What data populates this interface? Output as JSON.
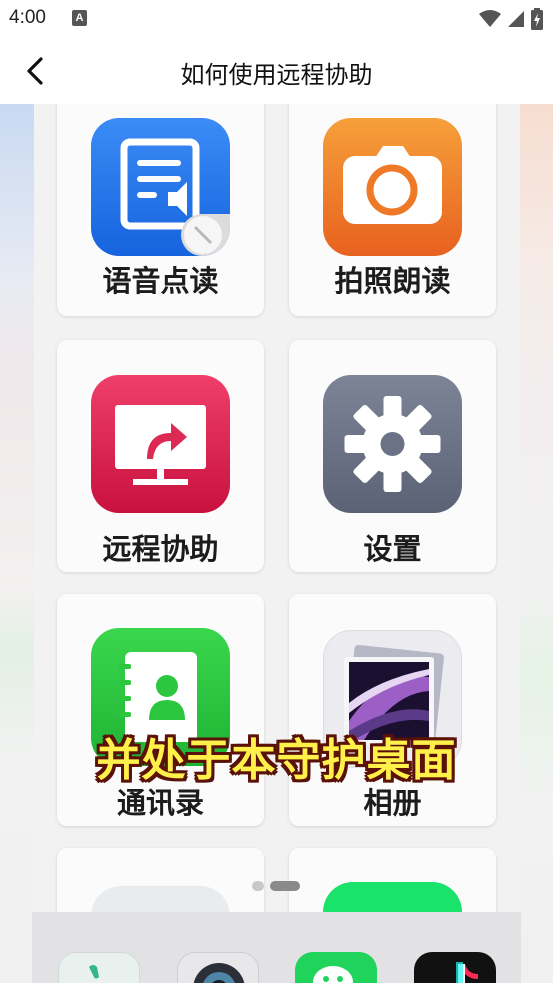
{
  "status_bar": {
    "time": "4:00",
    "notification_glyph": "A"
  },
  "header": {
    "title": "如何使用远程协助",
    "back_icon": "chevron-left-icon"
  },
  "grid": {
    "tiles": [
      {
        "label": "语音点读",
        "icon": "document-speaker-icon"
      },
      {
        "label": "拍照朗读",
        "icon": "camera-icon"
      },
      {
        "label": "远程协助",
        "icon": "remote-screen-icon"
      },
      {
        "label": "设置",
        "icon": "gear-icon"
      },
      {
        "label": "通讯录",
        "icon": "contacts-icon"
      },
      {
        "label": "相册",
        "icon": "photo-album-icon"
      }
    ]
  },
  "caption": "并处于本守护桌面",
  "pager": {
    "pages": 2,
    "active": 2
  },
  "dock": {
    "icons": [
      "phone-icon",
      "camera-lens-icon",
      "wechat-icon",
      "tiktok-icon"
    ]
  },
  "colors": {
    "caption_text": "#fff04a",
    "caption_outline": "#5a1208",
    "voice_icon_bg": "#1f6fe6",
    "camera_icon_bg": "#ee7a28",
    "remote_icon_bg": "#dc2a55",
    "settings_icon_bg": "#6b7286",
    "contacts_icon_bg": "#2cc63f"
  }
}
